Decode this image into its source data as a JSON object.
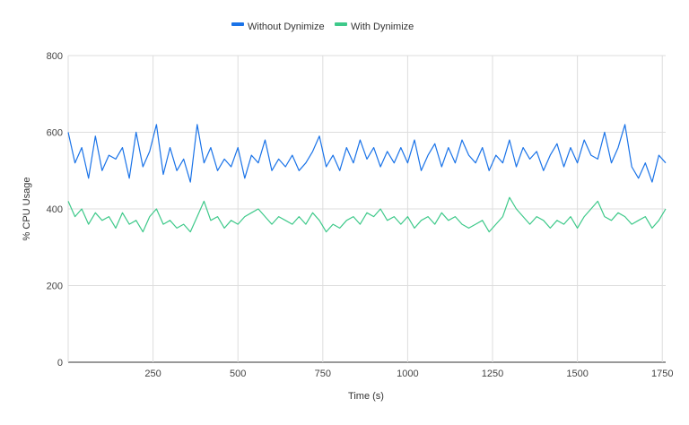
{
  "chart_data": {
    "type": "line",
    "title": "",
    "xlabel": "Time (s)",
    "ylabel": "% CPU Usage",
    "xlim": [
      0,
      1760
    ],
    "ylim": [
      0,
      800
    ],
    "x_ticks": [
      250,
      500,
      750,
      1000,
      1250,
      1500,
      1750
    ],
    "y_ticks": [
      0,
      200,
      400,
      600,
      800
    ],
    "grid": true,
    "legend_position": "top-center",
    "series": [
      {
        "name": "Without Dynimize",
        "color": "#1a73e8",
        "x": [
          0,
          20,
          40,
          60,
          80,
          100,
          120,
          140,
          160,
          180,
          200,
          220,
          240,
          260,
          280,
          300,
          320,
          340,
          360,
          380,
          400,
          420,
          440,
          460,
          480,
          500,
          520,
          540,
          560,
          580,
          600,
          620,
          640,
          660,
          680,
          700,
          720,
          740,
          760,
          780,
          800,
          820,
          840,
          860,
          880,
          900,
          920,
          940,
          960,
          980,
          1000,
          1020,
          1040,
          1060,
          1080,
          1100,
          1120,
          1140,
          1160,
          1180,
          1200,
          1220,
          1240,
          1260,
          1280,
          1300,
          1320,
          1340,
          1360,
          1380,
          1400,
          1420,
          1440,
          1460,
          1480,
          1500,
          1520,
          1540,
          1560,
          1580,
          1600,
          1620,
          1640,
          1660,
          1680,
          1700,
          1720,
          1740,
          1760
        ],
        "y": [
          600,
          520,
          560,
          480,
          590,
          500,
          540,
          530,
          560,
          480,
          600,
          510,
          550,
          620,
          490,
          560,
          500,
          530,
          470,
          620,
          520,
          560,
          500,
          530,
          510,
          560,
          480,
          540,
          520,
          580,
          500,
          530,
          510,
          540,
          500,
          520,
          550,
          590,
          510,
          540,
          500,
          560,
          520,
          580,
          530,
          560,
          510,
          550,
          520,
          560,
          520,
          580,
          500,
          540,
          570,
          510,
          560,
          520,
          580,
          540,
          520,
          560,
          500,
          540,
          520,
          580,
          510,
          560,
          530,
          550,
          500,
          540,
          570,
          510,
          560,
          520,
          580,
          540,
          530,
          600,
          520,
          560,
          620,
          510,
          480,
          520,
          470,
          540,
          520
        ]
      },
      {
        "name": "With Dynimize",
        "color": "#3ec98a",
        "x": [
          0,
          20,
          40,
          60,
          80,
          100,
          120,
          140,
          160,
          180,
          200,
          220,
          240,
          260,
          280,
          300,
          320,
          340,
          360,
          380,
          400,
          420,
          440,
          460,
          480,
          500,
          520,
          540,
          560,
          580,
          600,
          620,
          640,
          660,
          680,
          700,
          720,
          740,
          760,
          780,
          800,
          820,
          840,
          860,
          880,
          900,
          920,
          940,
          960,
          980,
          1000,
          1020,
          1040,
          1060,
          1080,
          1100,
          1120,
          1140,
          1160,
          1180,
          1200,
          1220,
          1240,
          1260,
          1280,
          1300,
          1320,
          1340,
          1360,
          1380,
          1400,
          1420,
          1440,
          1460,
          1480,
          1500,
          1520,
          1540,
          1560,
          1580,
          1600,
          1620,
          1640,
          1660,
          1680,
          1700,
          1720,
          1740,
          1760
        ],
        "y": [
          420,
          380,
          400,
          360,
          390,
          370,
          380,
          350,
          390,
          360,
          370,
          340,
          380,
          400,
          360,
          370,
          350,
          360,
          340,
          380,
          420,
          370,
          380,
          350,
          370,
          360,
          380,
          390,
          400,
          380,
          360,
          380,
          370,
          360,
          380,
          360,
          390,
          370,
          340,
          360,
          350,
          370,
          380,
          360,
          390,
          380,
          400,
          370,
          380,
          360,
          380,
          350,
          370,
          380,
          360,
          390,
          370,
          380,
          360,
          350,
          360,
          370,
          340,
          360,
          380,
          430,
          400,
          380,
          360,
          380,
          370,
          350,
          370,
          360,
          380,
          350,
          380,
          400,
          420,
          380,
          370,
          390,
          380,
          360,
          370,
          380,
          350,
          370,
          400
        ]
      }
    ]
  }
}
